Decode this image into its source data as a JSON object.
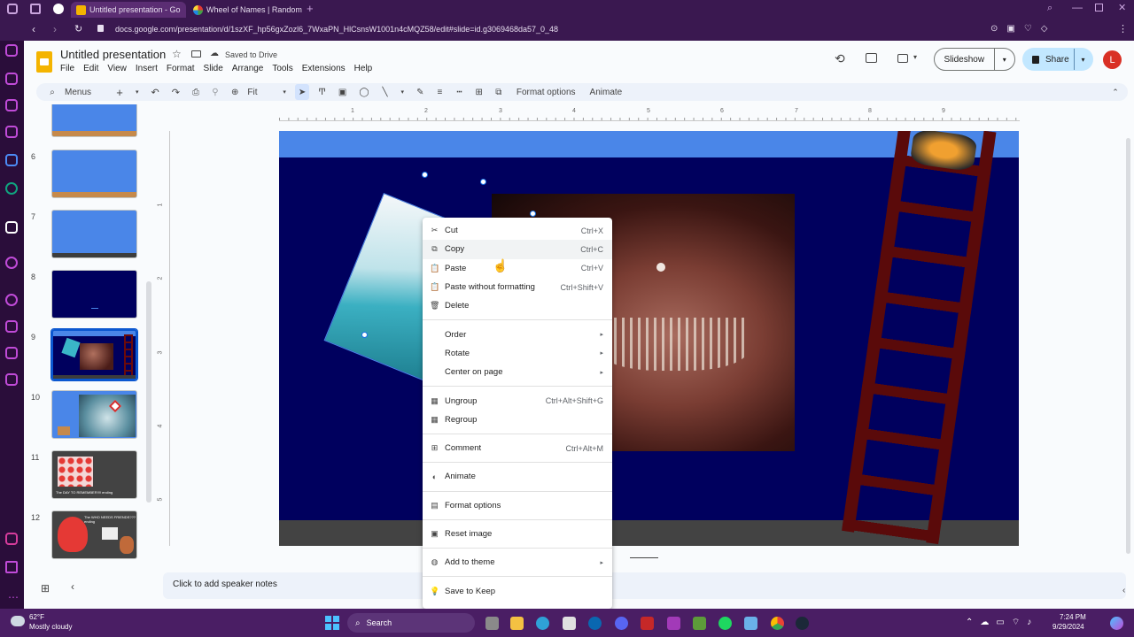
{
  "browser": {
    "tabs": [
      {
        "label": "Untitled presentation - Go",
        "active": true
      },
      {
        "label": "Wheel of Names | Random",
        "active": false
      }
    ],
    "url": "docs.google.com/presentation/d/1szXF_hp56gxZozl6_7WxaPN_HlCsnsW1001n4cMQZ58/edit#slide=id.g3069468da57_0_48"
  },
  "doc": {
    "title": "Untitled presentation",
    "saved_status": "Saved to Drive",
    "menu": [
      "File",
      "Edit",
      "View",
      "Insert",
      "Format",
      "Slide",
      "Arrange",
      "Tools",
      "Extensions",
      "Help"
    ],
    "slideshow_label": "Slideshow",
    "share_label": "Share",
    "avatar_letter": "L",
    "accent": "#0b57d0",
    "avatar_color": "#d93025"
  },
  "toolbar": {
    "menus_label": "Menus",
    "zoom_label": "Fit",
    "format_options_label": "Format options",
    "animate_label": "Animate"
  },
  "ruler": {
    "marks": [
      "1",
      "2",
      "3",
      "4",
      "5",
      "6",
      "7",
      "8",
      "9"
    ],
    "v_marks": [
      "1",
      "2",
      "3",
      "4",
      "5"
    ]
  },
  "filmstrip": {
    "slides": [
      {
        "num": "",
        "caption": ""
      },
      {
        "num": "6",
        "caption": ""
      },
      {
        "num": "7",
        "caption": ""
      },
      {
        "num": "8",
        "caption": ""
      },
      {
        "num": "9",
        "caption": "",
        "selected": true
      },
      {
        "num": "10",
        "caption": ""
      },
      {
        "num": "11",
        "caption": "The DAY TO REMEMBER!!!! ending"
      },
      {
        "num": "12",
        "caption": "The WHO NEEDS FRIENDS??? ending"
      }
    ]
  },
  "notes_placeholder": "Click to add speaker notes",
  "context_menu": {
    "items": [
      {
        "label": "Cut",
        "shortcut": "Ctrl+X",
        "icon": "scissors-icon"
      },
      {
        "label": "Copy",
        "shortcut": "Ctrl+C",
        "icon": "copy-icon",
        "highlight": true
      },
      {
        "label": "Paste",
        "shortcut": "Ctrl+V",
        "icon": "paste-icon"
      },
      {
        "label": "Paste without formatting",
        "shortcut": "Ctrl+Shift+V",
        "icon": "paste-plain-icon"
      },
      {
        "label": "Delete",
        "shortcut": "",
        "icon": "trash-icon"
      },
      {
        "sep": true
      },
      {
        "label": "Order",
        "shortcut": "",
        "submenu": true
      },
      {
        "label": "Rotate",
        "shortcut": "",
        "submenu": true
      },
      {
        "label": "Center on page",
        "shortcut": "",
        "submenu": true
      },
      {
        "sep": true
      },
      {
        "label": "Ungroup",
        "shortcut": "Ctrl+Alt+Shift+G",
        "icon": "ungroup-icon"
      },
      {
        "label": "Regroup",
        "shortcut": "",
        "icon": "regroup-icon"
      },
      {
        "sep": true
      },
      {
        "label": "Comment",
        "shortcut": "Ctrl+Alt+M",
        "icon": "comment-icon"
      },
      {
        "sep": true
      },
      {
        "label": "Animate",
        "shortcut": "",
        "icon": "animate-icon"
      },
      {
        "sep": true
      },
      {
        "label": "Format options",
        "shortcut": "",
        "icon": "format-options-icon"
      },
      {
        "sep": true
      },
      {
        "label": "Reset image",
        "shortcut": "",
        "icon": "reset-image-icon"
      },
      {
        "sep": true
      },
      {
        "label": "Add to theme",
        "shortcut": "",
        "icon": "theme-icon",
        "submenu": true
      },
      {
        "sep": true
      },
      {
        "label": "Save to Keep",
        "shortcut": "",
        "icon": "keep-icon"
      }
    ]
  },
  "taskbar": {
    "weather_temp": "62°F",
    "weather_desc": "Mostly cloudy",
    "search_label": "Search",
    "time": "7:24 PM",
    "date": "9/29/2024"
  }
}
